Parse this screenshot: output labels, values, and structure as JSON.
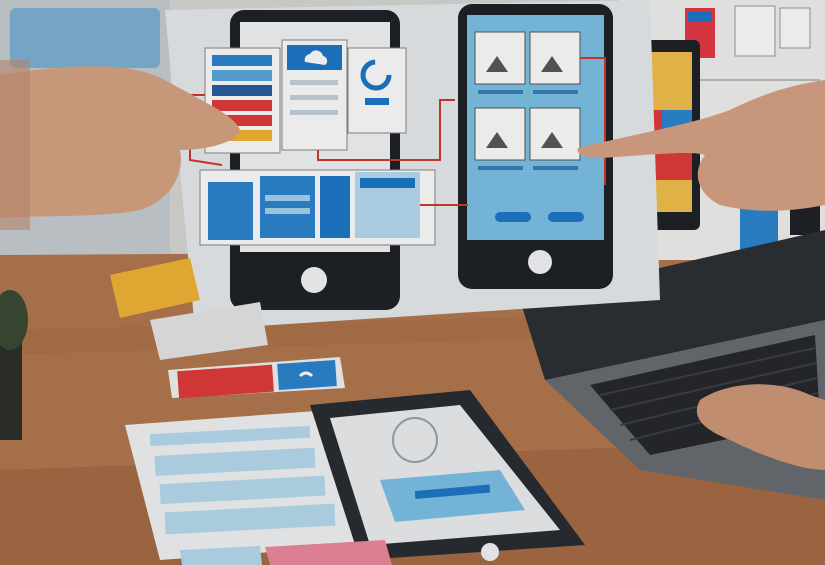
{
  "colors": {
    "wall": "#dcdcdc",
    "desk": "#b77a4f",
    "desk_dark": "#8a5330",
    "paper": "#eef0f2",
    "phone_dark": "#1f2227",
    "screen_blue": "#7dc3e8",
    "accent_blue": "#1e78c8",
    "accent_red": "#e23b3b",
    "accent_yellow": "#f2b636",
    "arrow_red": "#d23a2a",
    "laptop": "#3b3f44",
    "skin": "#d39a7a"
  },
  "icons": {
    "cloud_upload": "cloud-upload-icon",
    "image_placeholder": "image-placeholder-icon",
    "progress_ring": "progress-ring-icon",
    "call": "phone-call-icon"
  }
}
